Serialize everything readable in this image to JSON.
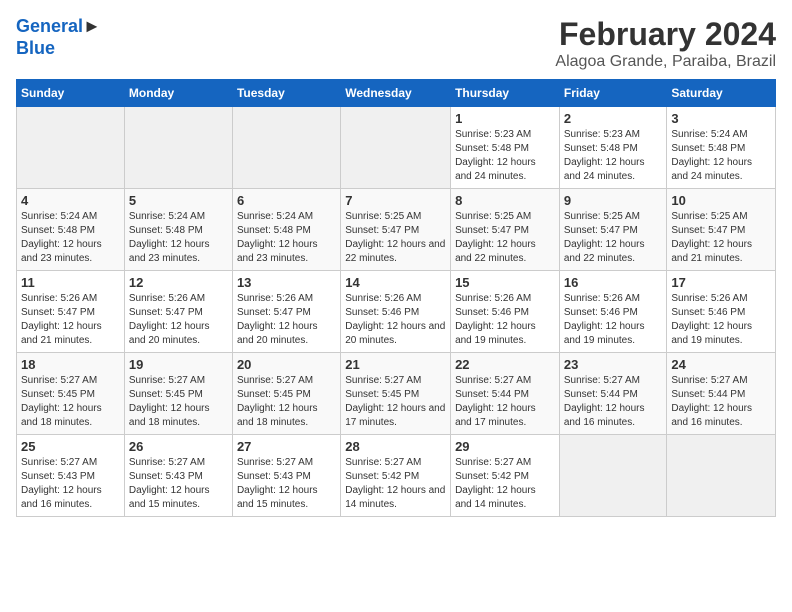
{
  "logo": {
    "line1": "General",
    "line2": "Blue"
  },
  "title": "February 2024",
  "subtitle": "Alagoa Grande, Paraiba, Brazil",
  "days_of_week": [
    "Sunday",
    "Monday",
    "Tuesday",
    "Wednesday",
    "Thursday",
    "Friday",
    "Saturday"
  ],
  "weeks": [
    [
      {
        "day": "",
        "info": ""
      },
      {
        "day": "",
        "info": ""
      },
      {
        "day": "",
        "info": ""
      },
      {
        "day": "",
        "info": ""
      },
      {
        "day": "1",
        "info": "Sunrise: 5:23 AM\nSunset: 5:48 PM\nDaylight: 12 hours and 24 minutes."
      },
      {
        "day": "2",
        "info": "Sunrise: 5:23 AM\nSunset: 5:48 PM\nDaylight: 12 hours and 24 minutes."
      },
      {
        "day": "3",
        "info": "Sunrise: 5:24 AM\nSunset: 5:48 PM\nDaylight: 12 hours and 24 minutes."
      }
    ],
    [
      {
        "day": "4",
        "info": "Sunrise: 5:24 AM\nSunset: 5:48 PM\nDaylight: 12 hours and 23 minutes."
      },
      {
        "day": "5",
        "info": "Sunrise: 5:24 AM\nSunset: 5:48 PM\nDaylight: 12 hours and 23 minutes."
      },
      {
        "day": "6",
        "info": "Sunrise: 5:24 AM\nSunset: 5:48 PM\nDaylight: 12 hours and 23 minutes."
      },
      {
        "day": "7",
        "info": "Sunrise: 5:25 AM\nSunset: 5:47 PM\nDaylight: 12 hours and 22 minutes."
      },
      {
        "day": "8",
        "info": "Sunrise: 5:25 AM\nSunset: 5:47 PM\nDaylight: 12 hours and 22 minutes."
      },
      {
        "day": "9",
        "info": "Sunrise: 5:25 AM\nSunset: 5:47 PM\nDaylight: 12 hours and 22 minutes."
      },
      {
        "day": "10",
        "info": "Sunrise: 5:25 AM\nSunset: 5:47 PM\nDaylight: 12 hours and 21 minutes."
      }
    ],
    [
      {
        "day": "11",
        "info": "Sunrise: 5:26 AM\nSunset: 5:47 PM\nDaylight: 12 hours and 21 minutes."
      },
      {
        "day": "12",
        "info": "Sunrise: 5:26 AM\nSunset: 5:47 PM\nDaylight: 12 hours and 20 minutes."
      },
      {
        "day": "13",
        "info": "Sunrise: 5:26 AM\nSunset: 5:47 PM\nDaylight: 12 hours and 20 minutes."
      },
      {
        "day": "14",
        "info": "Sunrise: 5:26 AM\nSunset: 5:46 PM\nDaylight: 12 hours and 20 minutes."
      },
      {
        "day": "15",
        "info": "Sunrise: 5:26 AM\nSunset: 5:46 PM\nDaylight: 12 hours and 19 minutes."
      },
      {
        "day": "16",
        "info": "Sunrise: 5:26 AM\nSunset: 5:46 PM\nDaylight: 12 hours and 19 minutes."
      },
      {
        "day": "17",
        "info": "Sunrise: 5:26 AM\nSunset: 5:46 PM\nDaylight: 12 hours and 19 minutes."
      }
    ],
    [
      {
        "day": "18",
        "info": "Sunrise: 5:27 AM\nSunset: 5:45 PM\nDaylight: 12 hours and 18 minutes."
      },
      {
        "day": "19",
        "info": "Sunrise: 5:27 AM\nSunset: 5:45 PM\nDaylight: 12 hours and 18 minutes."
      },
      {
        "day": "20",
        "info": "Sunrise: 5:27 AM\nSunset: 5:45 PM\nDaylight: 12 hours and 18 minutes."
      },
      {
        "day": "21",
        "info": "Sunrise: 5:27 AM\nSunset: 5:45 PM\nDaylight: 12 hours and 17 minutes."
      },
      {
        "day": "22",
        "info": "Sunrise: 5:27 AM\nSunset: 5:44 PM\nDaylight: 12 hours and 17 minutes."
      },
      {
        "day": "23",
        "info": "Sunrise: 5:27 AM\nSunset: 5:44 PM\nDaylight: 12 hours and 16 minutes."
      },
      {
        "day": "24",
        "info": "Sunrise: 5:27 AM\nSunset: 5:44 PM\nDaylight: 12 hours and 16 minutes."
      }
    ],
    [
      {
        "day": "25",
        "info": "Sunrise: 5:27 AM\nSunset: 5:43 PM\nDaylight: 12 hours and 16 minutes."
      },
      {
        "day": "26",
        "info": "Sunrise: 5:27 AM\nSunset: 5:43 PM\nDaylight: 12 hours and 15 minutes."
      },
      {
        "day": "27",
        "info": "Sunrise: 5:27 AM\nSunset: 5:43 PM\nDaylight: 12 hours and 15 minutes."
      },
      {
        "day": "28",
        "info": "Sunrise: 5:27 AM\nSunset: 5:42 PM\nDaylight: 12 hours and 14 minutes."
      },
      {
        "day": "29",
        "info": "Sunrise: 5:27 AM\nSunset: 5:42 PM\nDaylight: 12 hours and 14 minutes."
      },
      {
        "day": "",
        "info": ""
      },
      {
        "day": "",
        "info": ""
      }
    ]
  ]
}
